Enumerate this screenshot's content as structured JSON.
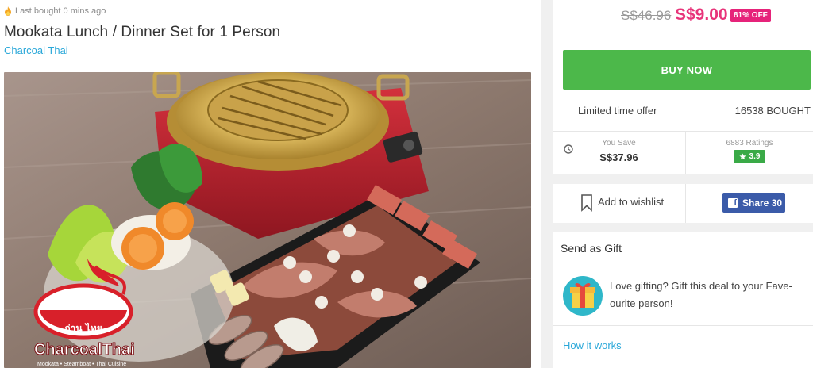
{
  "deal": {
    "last_bought": "Last bought 0 mins ago",
    "title": "Mookata Lunch / Dinner Set for 1 Person",
    "merchant": "Charcoal Thai",
    "logo_brand": "CharcoalThai",
    "logo_thai": "ถ่าน ไทย",
    "logo_tagline": "Mookata • Steamboat • Thai Cuisine"
  },
  "pricing": {
    "original": "S$46.96",
    "sale": "S$9.00",
    "discount_badge": "81% OFF"
  },
  "purchase": {
    "buy_label": "BUY NOW",
    "offer_label": "Limited time offer",
    "bought_count": "16538 BOUGHT",
    "save_label": "You Save",
    "save_value": "S$37.96",
    "ratings_label": "6883 Ratings",
    "rating_value": "3.9"
  },
  "social": {
    "wishlist_label": "Add to wishlist",
    "share_label": "Share 30"
  },
  "gift": {
    "title": "Send as Gift",
    "text": "Love gifting? Gift this deal to your Fave- ourite person!",
    "how_link": "How it works"
  },
  "icons": {
    "fire": "fire-icon",
    "clock": "clock-icon",
    "star": "star-icon",
    "bookmark": "bookmark-icon",
    "facebook": "facebook-icon",
    "gift": "gift-icon"
  },
  "colors": {
    "brand_pink": "#e8347a",
    "buy_green": "#4cb84a",
    "rating_green": "#3aaa47",
    "link_blue": "#2ba8d9",
    "facebook_blue": "#3b5ba9"
  }
}
